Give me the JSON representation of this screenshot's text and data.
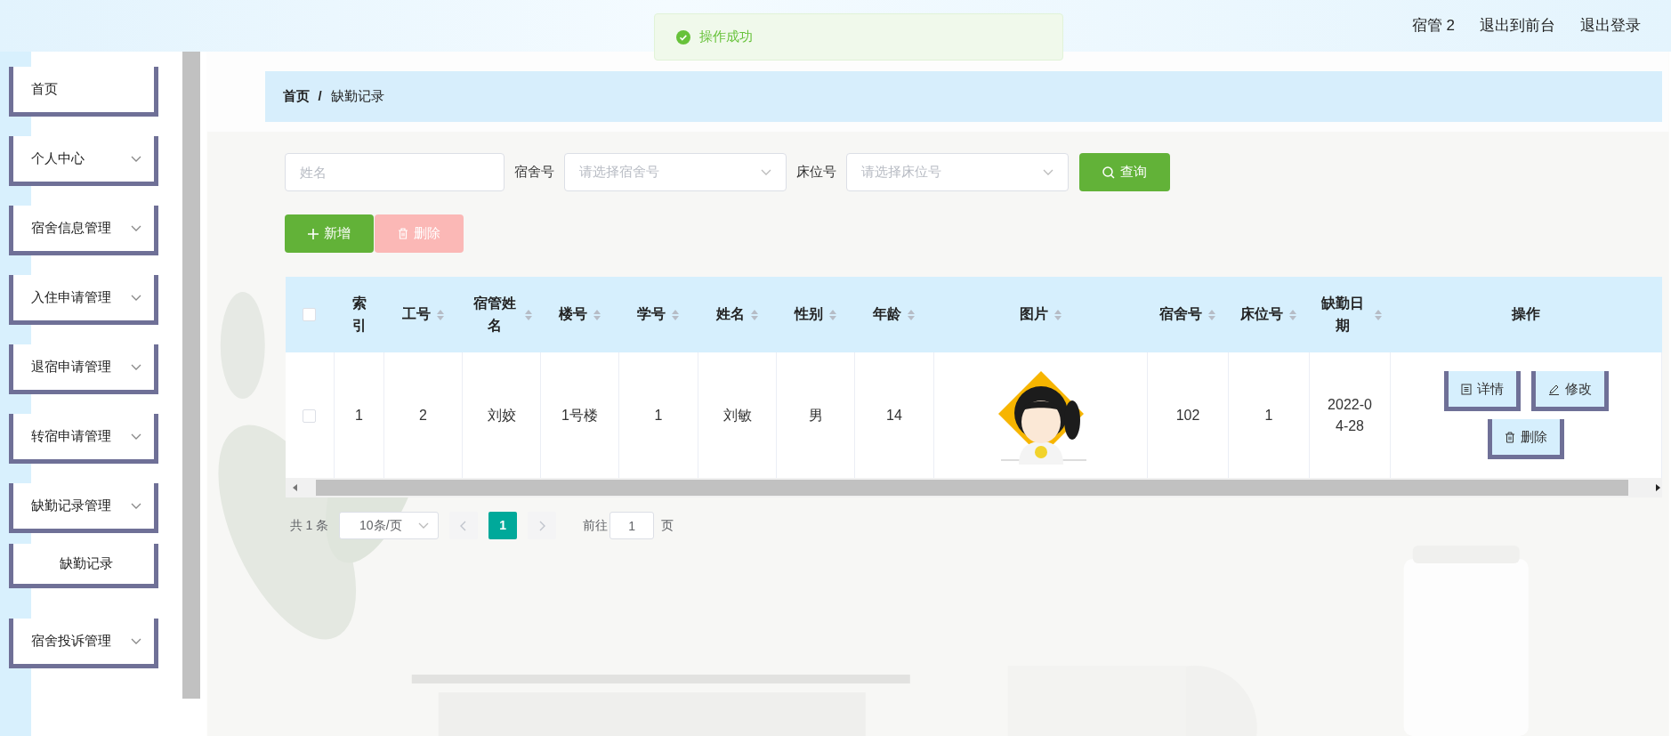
{
  "toast": {
    "message": "操作成功"
  },
  "header": {
    "user": "宿管 2",
    "links": [
      "退出到前台",
      "退出登录"
    ]
  },
  "sidebar": {
    "items": [
      {
        "label": "首页",
        "kind": "link"
      },
      {
        "label": "个人中心",
        "kind": "menu"
      },
      {
        "label": "宿舍信息管理",
        "kind": "menu"
      },
      {
        "label": "入住申请管理",
        "kind": "menu"
      },
      {
        "label": "退宿申请管理",
        "kind": "menu"
      },
      {
        "label": "转宿申请管理",
        "kind": "menu"
      },
      {
        "label": "缺勤记录管理",
        "kind": "menu",
        "children": [
          {
            "label": "缺勤记录"
          }
        ]
      },
      {
        "label": "宿舍投诉管理",
        "kind": "menu"
      }
    ]
  },
  "breadcrumb": {
    "items": [
      "首页",
      "缺勤记录"
    ],
    "separator": "/"
  },
  "search": {
    "name_placeholder": "姓名",
    "dorm_label": "宿舍号",
    "dorm_placeholder": "请选择宿舍号",
    "bed_label": "床位号",
    "bed_placeholder": "请选择床位号",
    "button": "查询"
  },
  "actions": [
    {
      "label": "新增",
      "kind": "add",
      "disabled": false
    },
    {
      "label": "删除",
      "kind": "delete",
      "disabled": true
    }
  ],
  "table": {
    "all_selected": false,
    "columns": [
      {
        "label": "索引",
        "sortable": false
      },
      {
        "label": "工号",
        "sortable": true
      },
      {
        "label": "宿管姓名",
        "sortable": true
      },
      {
        "label": "楼号",
        "sortable": true
      },
      {
        "label": "学号",
        "sortable": true
      },
      {
        "label": "姓名",
        "sortable": true
      },
      {
        "label": "性别",
        "sortable": true
      },
      {
        "label": "年龄",
        "sortable": true
      },
      {
        "label": "图片",
        "sortable": true,
        "kind": "picture"
      },
      {
        "label": "宿舍号",
        "sortable": true
      },
      {
        "label": "床位号",
        "sortable": true
      },
      {
        "label": "缺勤日期",
        "sortable": true
      },
      {
        "label": "操作",
        "sortable": false,
        "kind": "actions"
      }
    ],
    "rows": [
      {
        "selected": false,
        "cells": [
          "1",
          "2",
          "刘姣",
          "1号楼",
          "1",
          "刘敏",
          "男",
          "14",
          "",
          "102",
          "1",
          "2022-04-28"
        ],
        "actions": [
          {
            "label": "详情",
            "kind": "detail"
          },
          {
            "label": "修改",
            "kind": "edit"
          },
          {
            "label": "删除",
            "kind": "delete"
          }
        ]
      }
    ]
  },
  "pagination": {
    "total": "共 1 条",
    "page_size": "10条/页",
    "pages": [
      {
        "label": "1",
        "selected": true
      }
    ],
    "goto_label": "前往",
    "goto_value": "1",
    "page_suffix": "页"
  }
}
